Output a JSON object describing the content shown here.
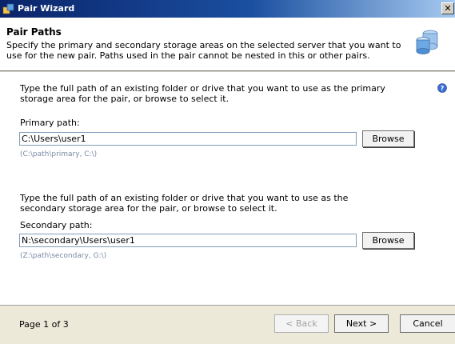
{
  "window": {
    "title": "Pair Wizard",
    "close_glyph": "✕"
  },
  "header": {
    "title": "Pair Paths",
    "description": "Specify the primary and secondary storage areas on the selected server that you want to use for the new pair. Paths used in the pair cannot be nested in this or other pairs.",
    "icon": "storage-database-icon"
  },
  "primary": {
    "instructions": "Type the full path of an existing folder or drive that you want to use as the primary storage area for the pair, or browse to select it.",
    "label": "Primary path:",
    "value": "C:\\Users\\user1",
    "hint": "(C:\\path\\primary, C:\\)",
    "browse_label": "Browse"
  },
  "secondary": {
    "instructions": "Type the full path of an existing folder or drive that you want to use as the secondary storage area for the pair, or browse to select it.",
    "label": "Secondary path:",
    "value": "N:\\secondary\\Users\\user1",
    "hint": "(Z:\\path\\secondary, G:\\)",
    "browse_label": "Browse"
  },
  "help_icon": "help-icon",
  "footer": {
    "page_text": "Page 1 of 3",
    "back_label": "< Back",
    "next_label": "Next >",
    "cancel_label": "Cancel"
  },
  "colors": {
    "titlebar_start": "#0a246a",
    "titlebar_end": "#a6caf0",
    "hint_text": "#7a8aa5",
    "footer_bg": "#ece9d8"
  }
}
